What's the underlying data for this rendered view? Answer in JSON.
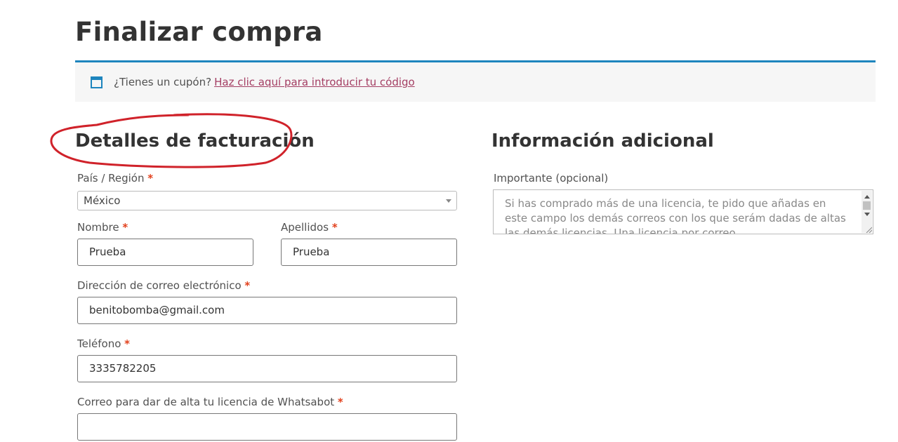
{
  "page": {
    "title": "Finalizar compra"
  },
  "coupon": {
    "icon": "window-icon",
    "text": "¿Tienes un cupón?",
    "link_text": "Haz clic aquí para introducir tu código",
    "accent_color": "#1e85be",
    "link_color": "#a43e63"
  },
  "billing": {
    "title": "Detalles de facturación",
    "annotation_color": "#d0222a",
    "required_mark": "*",
    "country": {
      "label": "País / Región",
      "value": "México"
    },
    "first_name": {
      "label": "Nombre",
      "value": "Prueba"
    },
    "last_name": {
      "label": "Apellidos",
      "value": "Prueba"
    },
    "email": {
      "label": "Dirección de correo electrónico",
      "value": "benitobomba@gmail.com"
    },
    "phone": {
      "label": "Teléfono",
      "value": "3335782205"
    },
    "whatsabot_email": {
      "label": "Correo para dar de alta tu licencia de Whatsabot",
      "value": ""
    }
  },
  "additional": {
    "title": "Información adicional",
    "notes": {
      "label": "Importante (opcional)",
      "placeholder": "Si has comprado más de una licencia, te pido que añadas en este campo los demás correos con los que serám dadas de altas las demás licencias. Una licencia por correo."
    }
  }
}
